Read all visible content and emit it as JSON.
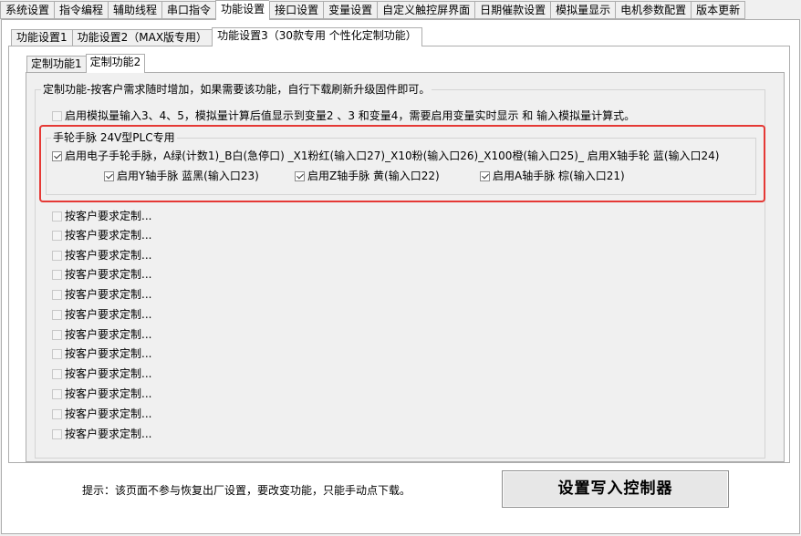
{
  "top_tabs": [
    "系统设置",
    "指令编程",
    "辅助线程",
    "串口指令",
    "功能设置",
    "接口设置",
    "变量设置",
    "自定义触控屏界面",
    "日期催款设置",
    "模拟量显示",
    "电机参数配置",
    "版本更新"
  ],
  "sub_tabs": [
    "功能设置1",
    "功能设置2（MAX版专用）",
    "功能设置3（30款专用 个性化定制功能）"
  ],
  "inner_tabs": [
    "定制功能1",
    "定制功能2"
  ],
  "custom_group": {
    "title": "定制功能-按客户需求随时增加，如果需要该功能，自行下载刷新升级固件即可。",
    "analog_option": "启用模拟量输入3、4、5，模拟量计算后值显示到变量2 、3 和变量4，需要启用变量实时显示 和 输入模拟量计算式。"
  },
  "handwheel_group": {
    "title": "手轮手脉 24V型PLC专用",
    "main_option": "启用电子手轮手脉，A绿(计数1)_B白(急停口) _X1粉红(输入口27)_X10粉(输入口26)_X100橙(输入口25)_  启用X轴手轮 蓝(输入口24)",
    "y_option": "启用Y轴手脉 蓝黑(输入口23)",
    "z_option": "启用Z轴手脉 黄(输入口22)",
    "a_option": "启用A轴手脉  棕(输入口21)"
  },
  "placeholder_label": "按客户要求定制...",
  "hint": "提示：该页面不参与恢复出厂设置，要改变功能，只能手动点下载。",
  "write_button": "设置写入控制器",
  "colors": {
    "highlight_border": "#e53935"
  }
}
